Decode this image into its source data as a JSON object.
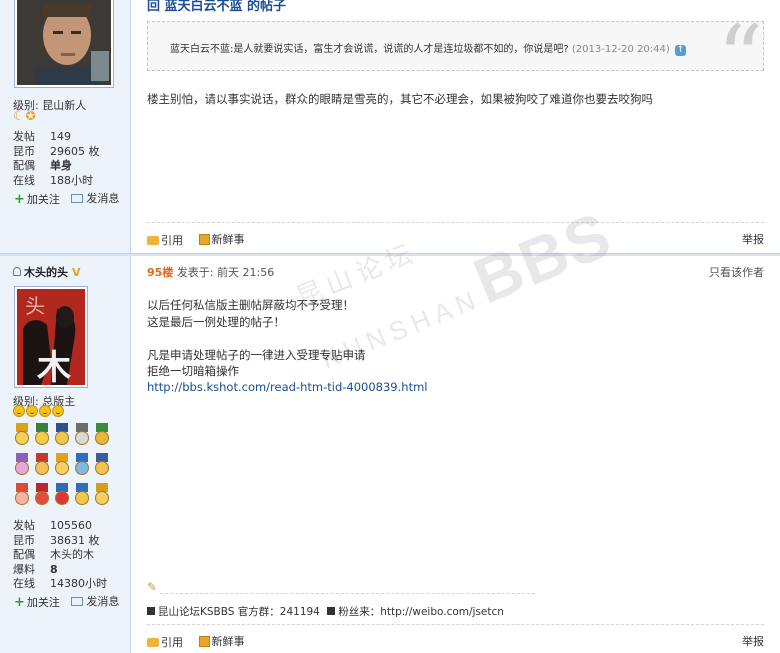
{
  "post1": {
    "level_label": "级别: 昆山新人",
    "stats": [
      {
        "key": "发帖",
        "value": "149",
        "bold": false
      },
      {
        "key": "昆币",
        "value": "29605 枚",
        "bold": false
      },
      {
        "key": "配偶",
        "value": "单身",
        "bold": true
      },
      {
        "key": "在线",
        "value": "188小时",
        "bold": false
      }
    ],
    "follow_label": "加关注",
    "message_label": "发消息",
    "reply_title": "回 蓝天白云不蓝 的帖子",
    "quote_text": "蓝天白云不蓝:是人就要说实话，富生才会说谎，说谎的人才是连垃圾都不如的，你说是吧?",
    "quote_date": "(2013-12-20 20:44)",
    "body": "楼主别怕，请以事实说话，群众的眼睛是雪亮的，其它不必理会，如果被狗咬了难道你也要去咬狗吗",
    "cite_label": "引用",
    "news_label": "新鲜事",
    "report_label": "举报"
  },
  "post2": {
    "author": "木头的头",
    "author_badge": "V",
    "floor": "95楼",
    "posted": "发表于: 前天 21:56",
    "only_author": "只看该作者",
    "avatar_text_top": "头",
    "avatar_text_bottom": "木",
    "level_label": "级别: 总版主",
    "stats": [
      {
        "key": "发帖",
        "value": "105560",
        "bold": false
      },
      {
        "key": "昆币",
        "value": "38631 枚",
        "bold": false
      },
      {
        "key": "配偶",
        "value": "木头的木",
        "bold": false
      },
      {
        "key": "爆料",
        "value": "8",
        "bold": true
      },
      {
        "key": "在线",
        "value": "14380小时",
        "bold": false
      }
    ],
    "follow_label": "加关注",
    "message_label": "发消息",
    "lines": [
      "以后任何私信版主删帖屏蔽均不予受理！",
      "这是最后一例处理的帖子！",
      "",
      "凡是申请处理帖子的一律进入受理专贴申请",
      "拒绝一切暗箱操作"
    ],
    "link": "http://bbs.kshot.com/read-htm-tid-4000839.html",
    "signature_a": "昆山论坛KSBBS 官方群：241194",
    "signature_b": "粉丝来：http://weibo.com/jsetcn",
    "cite_label": "引用",
    "news_label": "新鲜事",
    "report_label": "举报"
  },
  "watermark": {
    "big": "BBS",
    "small": "KUNSHAN",
    "cn": "昆山论坛"
  },
  "colors": {
    "title": "#1a4d94",
    "floor": "#e06a1a",
    "sidebar_bg": "#edf3fa"
  }
}
